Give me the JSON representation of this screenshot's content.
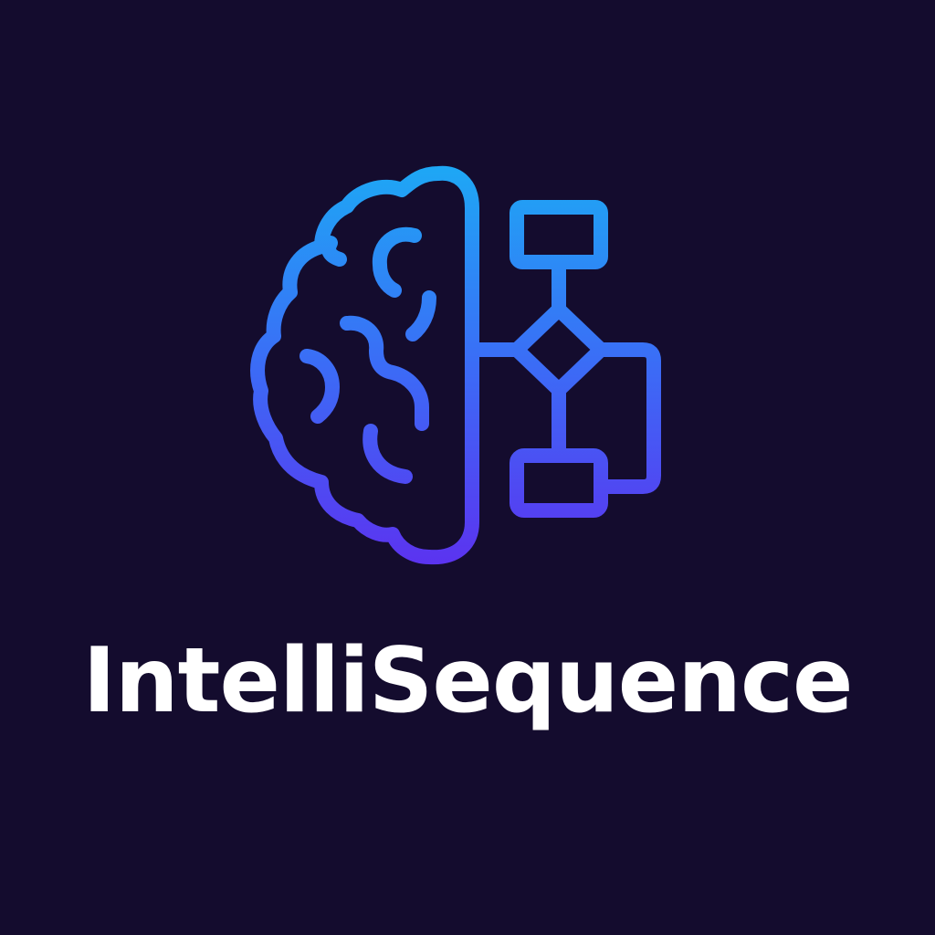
{
  "brand": {
    "name": "IntelliSequence"
  },
  "logo": {
    "icon_left": "brain-icon",
    "icon_right": "flowchart-icon",
    "background_color": "#140c2e",
    "gradient_top": "#1ea7f5",
    "gradient_mid": "#3b6cf6",
    "gradient_bottom": "#5b34f0",
    "text_color": "#ffffff"
  }
}
